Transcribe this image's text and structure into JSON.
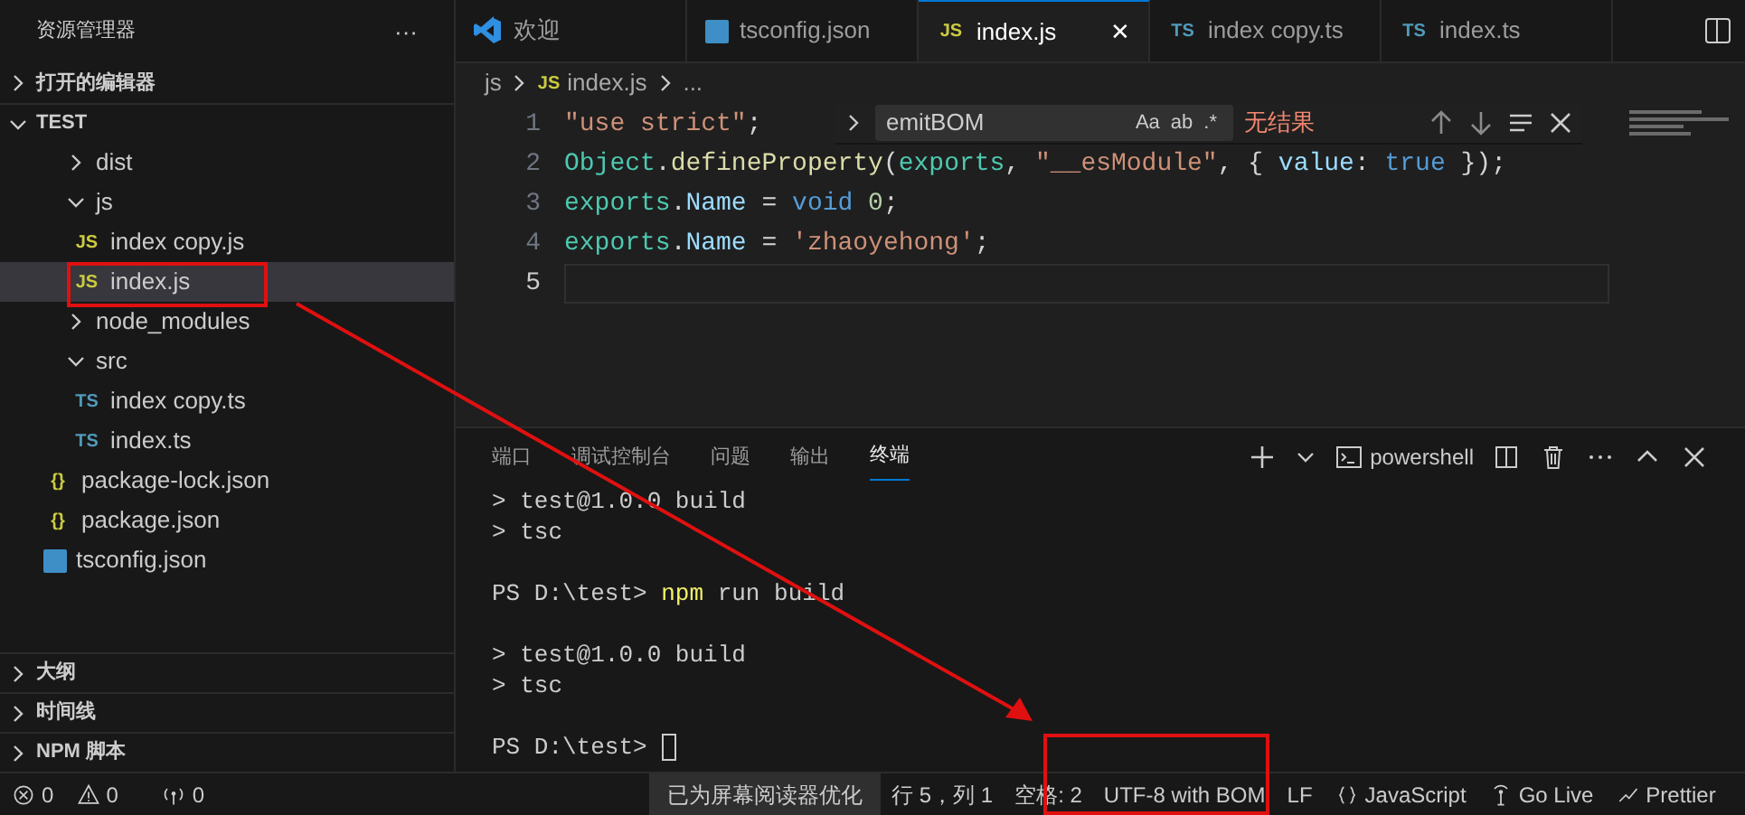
{
  "sidebar": {
    "title": "资源管理器",
    "more": "···",
    "sections": [
      {
        "label": "打开的编辑器",
        "expanded": false
      },
      {
        "label": "TEST",
        "expanded": true,
        "tree": [
          {
            "label": "dist",
            "kind": "folder",
            "expanded": false
          },
          {
            "label": "js",
            "kind": "folder",
            "expanded": true,
            "children": [
              {
                "label": "index copy.js",
                "kind": "js",
                "icon_text": "JS",
                "selected": false
              },
              {
                "label": "index.js",
                "kind": "js",
                "icon_text": "JS",
                "selected": true
              }
            ]
          },
          {
            "label": "node_modules",
            "kind": "folder",
            "expanded": false
          },
          {
            "label": "src",
            "kind": "folder",
            "expanded": true,
            "children": [
              {
                "label": "index copy.ts",
                "kind": "ts",
                "icon_text": "TS",
                "selected": false
              },
              {
                "label": "index.ts",
                "kind": "ts",
                "icon_text": "TS",
                "selected": false
              }
            ]
          },
          {
            "label": "package-lock.json",
            "kind": "json",
            "icon_text": "{}",
            "selected": false
          },
          {
            "label": "package.json",
            "kind": "json",
            "icon_text": "{}",
            "selected": false
          },
          {
            "label": "tsconfig.json",
            "kind": "tsconfig",
            "selected": false
          }
        ]
      }
    ],
    "bottom_sections": [
      {
        "label": "大纲",
        "expanded": false
      },
      {
        "label": "时间线",
        "expanded": false
      },
      {
        "label": "NPM 脚本",
        "expanded": false
      }
    ]
  },
  "tabs": [
    {
      "label": "欢迎",
      "kind": "welcome",
      "selected": false
    },
    {
      "label": "tsconfig.json",
      "kind": "tsconfig",
      "selected": false
    },
    {
      "label": "index.js",
      "kind": "js",
      "icon_text": "JS",
      "selected": true,
      "close": "✕"
    },
    {
      "label": "index copy.ts",
      "kind": "ts",
      "icon_text": "TS",
      "selected": false
    },
    {
      "label": "index.ts",
      "kind": "ts",
      "icon_text": "TS",
      "selected": false
    }
  ],
  "breadcrumb": [
    {
      "label": "js"
    },
    {
      "label": "index.js",
      "icon_text": "JS"
    },
    {
      "label": "..."
    }
  ],
  "code": [
    {
      "number": "1",
      "current": false,
      "tokens": [
        {
          "text": "\"use strict\"",
          "kind": "string"
        },
        {
          "text": ";",
          "kind": "plain"
        }
      ]
    },
    {
      "number": "2",
      "current": false,
      "tokens": [
        {
          "text": "Object",
          "kind": "type"
        },
        {
          "text": ".",
          "kind": "plain"
        },
        {
          "text": "defineProperty",
          "kind": "function"
        },
        {
          "text": "(",
          "kind": "plain"
        },
        {
          "text": "exports",
          "kind": "type"
        },
        {
          "text": ", ",
          "kind": "plain"
        },
        {
          "text": "\"__esModule\"",
          "kind": "string"
        },
        {
          "text": ", { ",
          "kind": "plain"
        },
        {
          "text": "value",
          "kind": "variable"
        },
        {
          "text": ": ",
          "kind": "plain"
        },
        {
          "text": "true",
          "kind": "keyword"
        },
        {
          "text": " });",
          "kind": "plain"
        }
      ]
    },
    {
      "number": "3",
      "current": false,
      "tokens": [
        {
          "text": "exports",
          "kind": "type"
        },
        {
          "text": ".",
          "kind": "plain"
        },
        {
          "text": "Name",
          "kind": "variable"
        },
        {
          "text": " = ",
          "kind": "plain"
        },
        {
          "text": "void",
          "kind": "keyword"
        },
        {
          "text": " 0",
          "kind": "number"
        },
        {
          "text": ";",
          "kind": "plain"
        }
      ]
    },
    {
      "number": "4",
      "current": false,
      "tokens": [
        {
          "text": "exports",
          "kind": "type"
        },
        {
          "text": ".",
          "kind": "plain"
        },
        {
          "text": "Name",
          "kind": "variable"
        },
        {
          "text": " = ",
          "kind": "plain"
        },
        {
          "text": "'zhaoyehong'",
          "kind": "string"
        },
        {
          "text": ";",
          "kind": "plain"
        }
      ]
    },
    {
      "number": "5",
      "current": true
    }
  ],
  "find_widget": {
    "value": "emitBOM",
    "options": [
      "Aa",
      "ab",
      ".*"
    ],
    "result": "无结果"
  },
  "panel": {
    "tabs": [
      {
        "label": "端口",
        "selected": false
      },
      {
        "label": "调试控制台",
        "selected": false
      },
      {
        "label": "问题",
        "selected": false
      },
      {
        "label": "输出",
        "selected": false
      },
      {
        "label": "终端",
        "selected": true
      }
    ],
    "terminal_name": "powershell",
    "terminal_blocks": [
      [
        {
          "segments": [
            {
              "text": "> test@1.0.0 build",
              "kind": "plain"
            }
          ]
        },
        {
          "segments": [
            {
              "text": "> tsc",
              "kind": "plain"
            }
          ]
        }
      ],
      [
        {
          "segments": [
            {
              "text": "PS D:\\test> ",
              "kind": "plain"
            },
            {
              "text": "npm",
              "kind": "command"
            },
            {
              "text": " run build",
              "kind": "plain"
            }
          ]
        }
      ],
      [
        {
          "segments": [
            {
              "text": "> test@1.0.0 build",
              "kind": "plain"
            }
          ]
        },
        {
          "segments": [
            {
              "text": "> tsc",
              "kind": "plain"
            }
          ]
        }
      ],
      [
        {
          "segments": [
            {
              "text": "PS D:\\test> ",
              "kind": "plain"
            }
          ],
          "cursor": true
        }
      ]
    ]
  },
  "status_bar": [
    {
      "kind": "errors",
      "text": "0"
    },
    {
      "kind": "warnings",
      "text": "0"
    },
    {
      "kind": "ports",
      "text": "0"
    },
    {
      "kind": "highlight",
      "text": "已为屏幕阅读器优化"
    },
    {
      "kind": "plain",
      "text": "行 5，列 1"
    },
    {
      "kind": "plain",
      "text": "空格: 2"
    },
    {
      "kind": "plain",
      "text": "UTF-8 with BOM"
    },
    {
      "kind": "plain",
      "text": "LF"
    },
    {
      "kind": "language",
      "text": "JavaScript"
    },
    {
      "kind": "golive",
      "text": "Go Live"
    },
    {
      "kind": "prettier",
      "text": "Prettier"
    }
  ],
  "annotations": [
    {
      "kind": "box"
    },
    {
      "kind": "box"
    },
    {
      "kind": "arrow"
    }
  ]
}
